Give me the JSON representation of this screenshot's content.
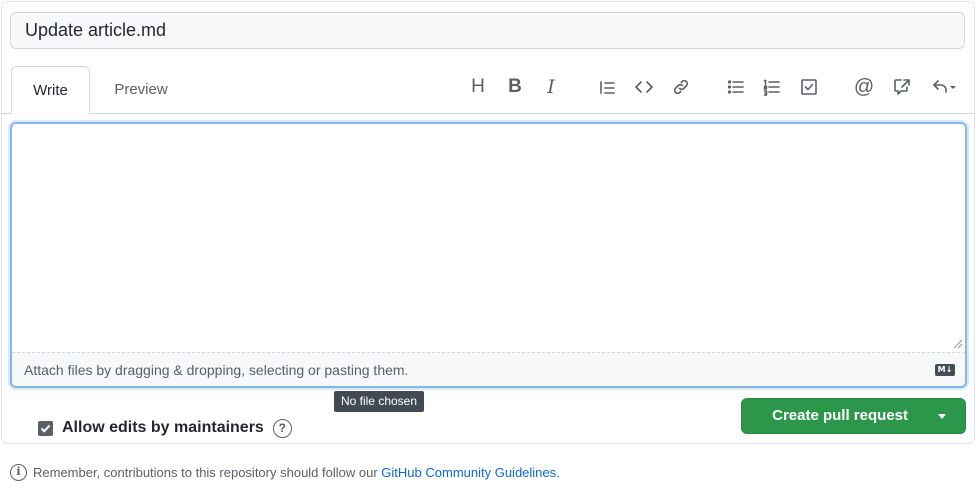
{
  "title_input": {
    "value": "Update article.md"
  },
  "tabs": {
    "write": "Write",
    "preview": "Preview"
  },
  "toolbar": {
    "heading_glyph": "H",
    "bold_glyph": "B",
    "italic_glyph": "I",
    "mention_glyph": "@",
    "icons": [
      "heading-icon",
      "bold-icon",
      "italic-icon",
      "quote-icon",
      "code-icon",
      "link-icon",
      "unordered-list-icon",
      "ordered-list-icon",
      "task-list-icon",
      "mention-icon",
      "cross-reference-icon",
      "reply-icon"
    ]
  },
  "editor": {
    "body_value": "",
    "attach_text": "Attach files by dragging & dropping, selecting or pasting them.",
    "markdown_badge": "M↓"
  },
  "tooltip": {
    "text": "No file chosen"
  },
  "allow_edits": {
    "label": "Allow edits by maintainers",
    "checked": true,
    "help_glyph": "?"
  },
  "create_button": {
    "label": "Create pull request",
    "accent": "#2c974b"
  },
  "footer": {
    "info_glyph": "i",
    "prefix": "Remember, contributions to this repository should follow our",
    "link_text": "GitHub Community Guidelines",
    "suffix": "."
  },
  "colors": {
    "link": "#0969da",
    "focus_border": "#85b6e8",
    "muted_text": "#57606a"
  }
}
